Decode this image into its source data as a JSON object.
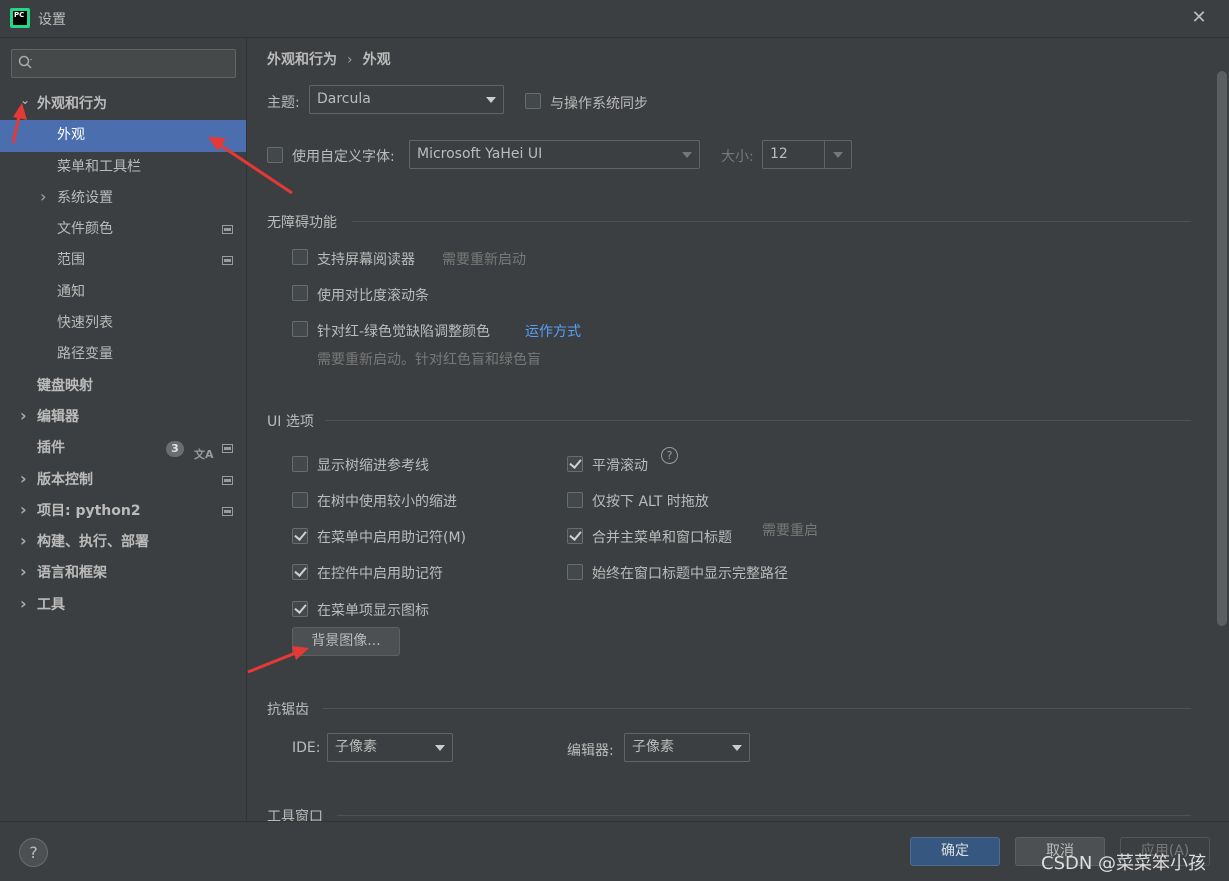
{
  "window": {
    "title": "设置"
  },
  "sidebar": {
    "search_placeholder": "",
    "items": [
      {
        "label": "外观和行为",
        "level": 0,
        "expandable": true,
        "expanded": true,
        "bold": true
      },
      {
        "label": "外观",
        "level": 1,
        "selected": true
      },
      {
        "label": "菜单和工具栏",
        "level": 1
      },
      {
        "label": "系统设置",
        "level": 1,
        "expandable": true
      },
      {
        "label": "文件颜色",
        "level": 1,
        "icon": "project-level-icon"
      },
      {
        "label": "范围",
        "level": 1,
        "icon": "project-level-icon"
      },
      {
        "label": "通知",
        "level": 1
      },
      {
        "label": "快速列表",
        "level": 1
      },
      {
        "label": "路径变量",
        "level": 1
      },
      {
        "label": "键盘映射",
        "level": 0,
        "bold": true
      },
      {
        "label": "编辑器",
        "level": 0,
        "expandable": true,
        "bold": true
      },
      {
        "label": "插件",
        "level": 0,
        "bold": true,
        "badge": "3",
        "icon": "project-level-icon"
      },
      {
        "label": "版本控制",
        "level": 0,
        "expandable": true,
        "bold": true,
        "icon": "project-level-icon"
      },
      {
        "label": "项目: python2",
        "level": 0,
        "expandable": true,
        "bold": true,
        "icon": "project-level-icon"
      },
      {
        "label": "构建、执行、部署",
        "level": 0,
        "expandable": true,
        "bold": true
      },
      {
        "label": "语言和框架",
        "level": 0,
        "expandable": true,
        "bold": true
      },
      {
        "label": "工具",
        "level": 0,
        "expandable": true,
        "bold": true
      }
    ]
  },
  "breadcrumb": {
    "parent": "外观和行为",
    "separator": "›",
    "current": "外观"
  },
  "theme": {
    "label": "主题:",
    "value": "Darcula",
    "sync_label": "与操作系统同步",
    "sync_checked": false
  },
  "font": {
    "custom_label": "使用自定义字体:",
    "custom_checked": false,
    "family": "Microsoft YaHei UI",
    "size_label": "大小:",
    "size": "12"
  },
  "accessibility": {
    "title": "无障碍功能",
    "screen_reader": {
      "label": "支持屏幕阅读器",
      "hint": "需要重新启动",
      "checked": false
    },
    "contrast_scrollbars": {
      "label": "使用对比度滚动条",
      "checked": false
    },
    "color_blind": {
      "label": "针对红-绿色觉缺陷调整颜色",
      "link": "运作方式",
      "hint": "需要重新启动。针对红色盲和绿色盲",
      "checked": false
    }
  },
  "ui_options": {
    "title": "UI 选项",
    "left": [
      {
        "label": "显示树缩进参考线",
        "checked": false
      },
      {
        "label": "在树中使用较小的缩进",
        "checked": false
      },
      {
        "label": "在菜单中启用助记符(M)",
        "checked": true
      },
      {
        "label": "在控件中启用助记符",
        "checked": true
      },
      {
        "label": "在菜单项显示图标",
        "checked": true
      }
    ],
    "right": [
      {
        "label": "平滑滚动",
        "checked": true
      },
      {
        "label": "仅按下 ALT 时拖放",
        "checked": false
      },
      {
        "label": "合并主菜单和窗口标题",
        "checked": true,
        "hint": "需要重启"
      },
      {
        "label": "始终在窗口标题中显示完整路径",
        "checked": false
      }
    ],
    "background_button": "背景图像..."
  },
  "antialiasing": {
    "title": "抗锯齿",
    "ide_label": "IDE:",
    "ide_value": "子像素",
    "editor_label": "编辑器:",
    "editor_value": "子像素"
  },
  "tool_windows": {
    "title": "工具窗口"
  },
  "footer": {
    "help": "?",
    "ok": "确定",
    "cancel": "取消",
    "apply": "应用(A)",
    "watermark": "CSDN @菜菜笨小孩"
  },
  "colors": {
    "background": "#3c3f41",
    "selection": "#4b6eaf",
    "link": "#589df6",
    "primary_button": "#365880",
    "annotation_arrow": "#e53935"
  }
}
